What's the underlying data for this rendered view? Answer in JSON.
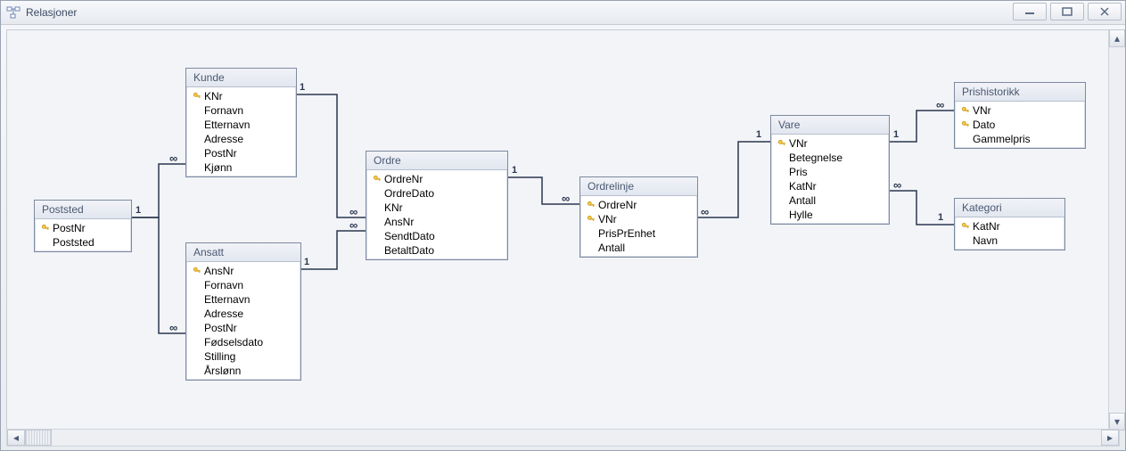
{
  "window": {
    "title": "Relasjoner"
  },
  "tables": {
    "poststed": {
      "title": "Poststed",
      "fields": [
        {
          "name": "PostNr",
          "pk": true
        },
        {
          "name": "Poststed",
          "pk": false
        }
      ]
    },
    "kunde": {
      "title": "Kunde",
      "fields": [
        {
          "name": "KNr",
          "pk": true
        },
        {
          "name": "Fornavn",
          "pk": false
        },
        {
          "name": "Etternavn",
          "pk": false
        },
        {
          "name": "Adresse",
          "pk": false
        },
        {
          "name": "PostNr",
          "pk": false
        },
        {
          "name": "Kjønn",
          "pk": false
        }
      ]
    },
    "ansatt": {
      "title": "Ansatt",
      "fields": [
        {
          "name": "AnsNr",
          "pk": true
        },
        {
          "name": "Fornavn",
          "pk": false
        },
        {
          "name": "Etternavn",
          "pk": false
        },
        {
          "name": "Adresse",
          "pk": false
        },
        {
          "name": "PostNr",
          "pk": false
        },
        {
          "name": "Fødselsdato",
          "pk": false
        },
        {
          "name": "Stilling",
          "pk": false
        },
        {
          "name": "Årslønn",
          "pk": false
        }
      ]
    },
    "ordre": {
      "title": "Ordre",
      "fields": [
        {
          "name": "OrdreNr",
          "pk": true
        },
        {
          "name": "OrdreDato",
          "pk": false
        },
        {
          "name": "KNr",
          "pk": false
        },
        {
          "name": "AnsNr",
          "pk": false
        },
        {
          "name": "SendtDato",
          "pk": false
        },
        {
          "name": "BetaltDato",
          "pk": false
        }
      ]
    },
    "ordrelinje": {
      "title": "Ordrelinje",
      "fields": [
        {
          "name": "OrdreNr",
          "pk": true
        },
        {
          "name": "VNr",
          "pk": true
        },
        {
          "name": "PrisPrEnhet",
          "pk": false
        },
        {
          "name": "Antall",
          "pk": false
        }
      ]
    },
    "vare": {
      "title": "Vare",
      "fields": [
        {
          "name": "VNr",
          "pk": true
        },
        {
          "name": "Betegnelse",
          "pk": false
        },
        {
          "name": "Pris",
          "pk": false
        },
        {
          "name": "KatNr",
          "pk": false
        },
        {
          "name": "Antall",
          "pk": false
        },
        {
          "name": "Hylle",
          "pk": false
        }
      ]
    },
    "prishistorikk": {
      "title": "Prishistorikk",
      "fields": [
        {
          "name": "VNr",
          "pk": true
        },
        {
          "name": "Dato",
          "pk": true
        },
        {
          "name": "Gammelpris",
          "pk": false
        }
      ]
    },
    "kategori": {
      "title": "Kategori",
      "fields": [
        {
          "name": "KatNr",
          "pk": true
        },
        {
          "name": "Navn",
          "pk": false
        }
      ]
    }
  },
  "cardinality": {
    "one": "1",
    "many": "∞"
  },
  "relationships": [
    {
      "from": "poststed.PostNr",
      "to": "kunde.PostNr",
      "from_card": "1",
      "to_card": "∞"
    },
    {
      "from": "poststed.PostNr",
      "to": "ansatt.PostNr",
      "from_card": "1",
      "to_card": "∞"
    },
    {
      "from": "kunde.KNr",
      "to": "ordre.KNr",
      "from_card": "1",
      "to_card": "∞"
    },
    {
      "from": "ansatt.AnsNr",
      "to": "ordre.AnsNr",
      "from_card": "1",
      "to_card": "∞"
    },
    {
      "from": "ordre.OrdreNr",
      "to": "ordrelinje.OrdreNr",
      "from_card": "1",
      "to_card": "∞"
    },
    {
      "from": "vare.VNr",
      "to": "ordrelinje.VNr",
      "from_card": "1",
      "to_card": "∞"
    },
    {
      "from": "vare.VNr",
      "to": "prishistorikk.VNr",
      "from_card": "1",
      "to_card": "∞"
    },
    {
      "from": "kategori.KatNr",
      "to": "vare.KatNr",
      "from_card": "1",
      "to_card": "∞"
    }
  ],
  "chart_data": {
    "type": "table",
    "description": "Entity-relationship diagram (MS Access Relationships window)",
    "entities": [
      "Poststed",
      "Kunde",
      "Ansatt",
      "Ordre",
      "Ordrelinje",
      "Vare",
      "Prishistorikk",
      "Kategori"
    ],
    "relationships": [
      {
        "from": "Poststed",
        "to": "Kunde",
        "cardinality": "1:∞"
      },
      {
        "from": "Poststed",
        "to": "Ansatt",
        "cardinality": "1:∞"
      },
      {
        "from": "Kunde",
        "to": "Ordre",
        "cardinality": "1:∞"
      },
      {
        "from": "Ansatt",
        "to": "Ordre",
        "cardinality": "1:∞"
      },
      {
        "from": "Ordre",
        "to": "Ordrelinje",
        "cardinality": "1:∞"
      },
      {
        "from": "Vare",
        "to": "Ordrelinje",
        "cardinality": "1:∞"
      },
      {
        "from": "Vare",
        "to": "Prishistorikk",
        "cardinality": "1:∞"
      },
      {
        "from": "Kategori",
        "to": "Vare",
        "cardinality": "1:∞"
      }
    ]
  }
}
